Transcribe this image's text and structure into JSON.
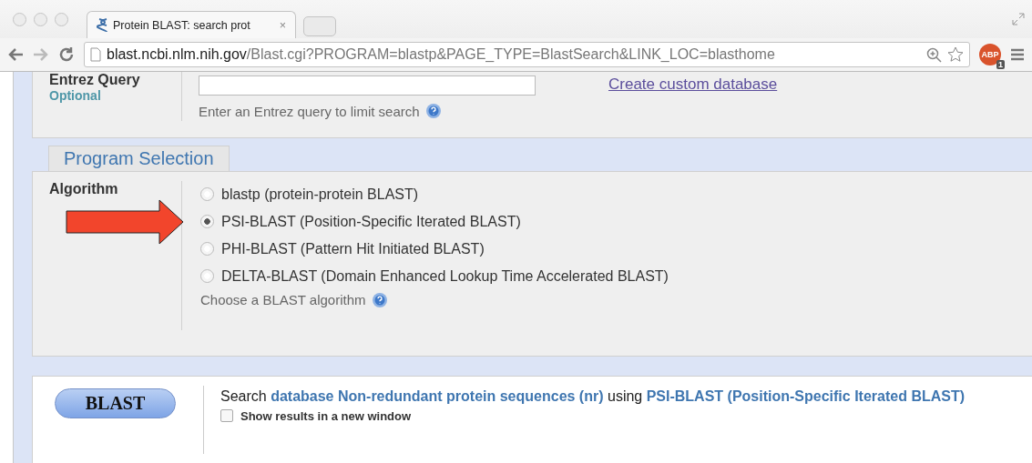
{
  "browser": {
    "tab_title": "Protein BLAST: search prot",
    "tab_close": "×",
    "url_host": "blast.ncbi.nlm.nih.gov",
    "url_path": "/Blast.cgi?PROGRAM=blastp&PAGE_TYPE=BlastSearch&LINK_LOC=blasthome",
    "extension_badge": "ABP",
    "extension_count": "1"
  },
  "entrez": {
    "label": "Entrez Query",
    "sublabel": "Optional",
    "hint": "Enter an Entrez query to limit search",
    "link": "Create custom database"
  },
  "program_selection": {
    "legend": "Program Selection",
    "label": "Algorithm",
    "hint": "Choose a BLAST algorithm",
    "algorithms": [
      {
        "label": "blastp (protein-protein BLAST)",
        "selected": false
      },
      {
        "label": "PSI-BLAST (Position-Specific Iterated BLAST)",
        "selected": true
      },
      {
        "label": "PHI-BLAST (Pattern Hit Initiated BLAST)",
        "selected": false
      },
      {
        "label": "DELTA-BLAST (Domain Enhanced Lookup Time Accelerated BLAST)",
        "selected": false
      }
    ]
  },
  "submit": {
    "button": "BLAST",
    "summary": "Search **database Non-redundant protein sequences (nr)** using **PSI-BLAST (Position-Specific Iterated BLAST)**",
    "new_window": {
      "label": "Show results in a new window",
      "checked": false
    }
  }
}
